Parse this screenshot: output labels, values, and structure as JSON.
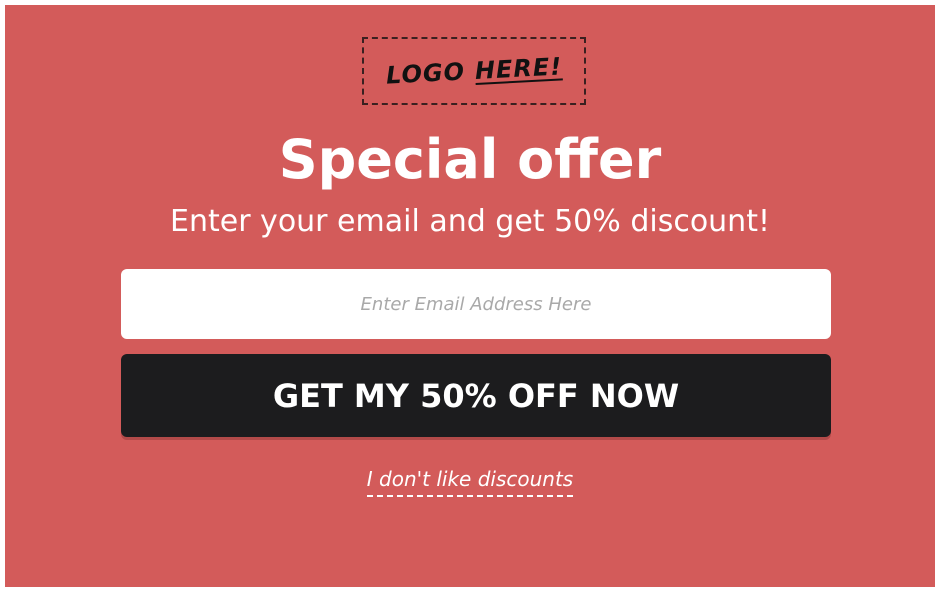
{
  "popup": {
    "logo": {
      "word_1": "LOGO",
      "word_2": "HERE!"
    },
    "title": "Special offer",
    "subtitle": "Enter your email and get 50% discount!",
    "email_input": {
      "value": "",
      "placeholder": "Enter Email Address Here"
    },
    "cta_button_label": "GET MY 50% OFF NOW",
    "decline_link_label": "I don't like discounts"
  },
  "colors": {
    "background": "#d35b5a",
    "button": "#1c1c1e",
    "text": "#ffffff"
  }
}
